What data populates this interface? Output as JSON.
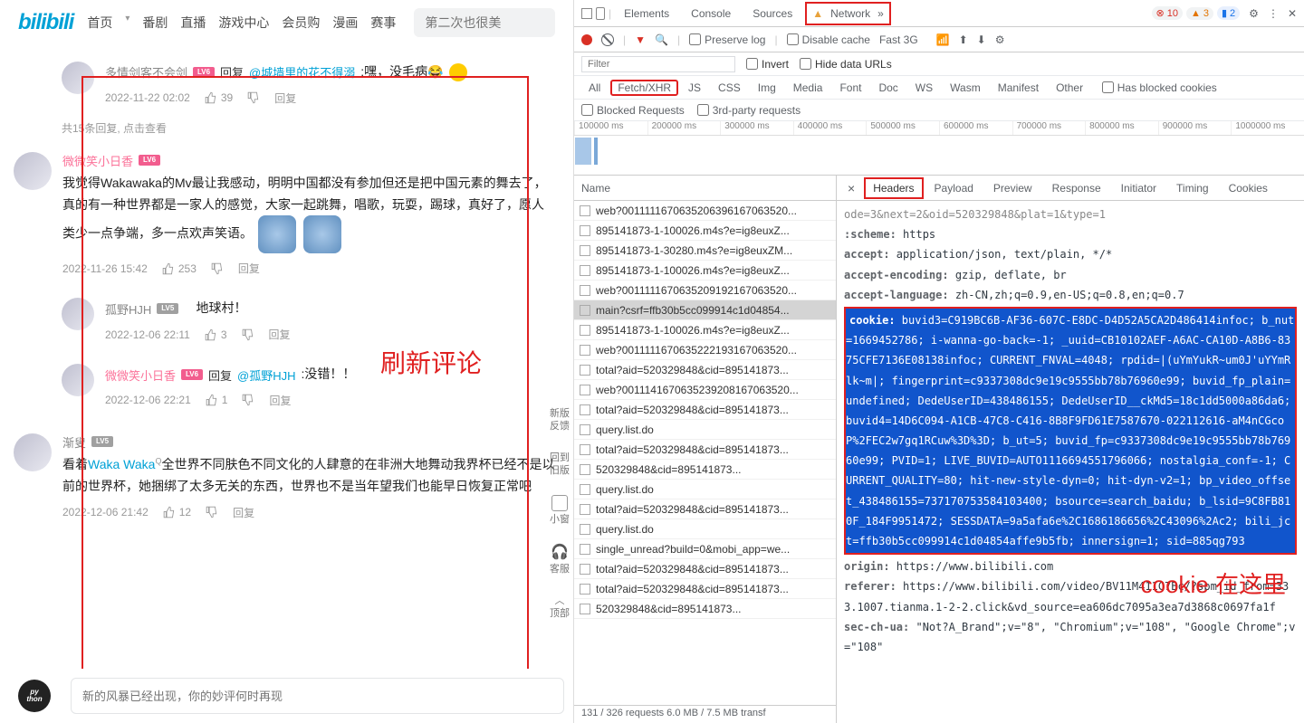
{
  "bili": {
    "logo": "bilibili",
    "nav": [
      "首页",
      "番剧",
      "直播",
      "游戏中心",
      "会员购",
      "漫画",
      "赛事"
    ],
    "search_placeholder": "第二次也很美",
    "reply_label": "回复",
    "reply_count_text": "共15条回复, 点击查看",
    "sidebar": [
      {
        "label": "新版\n反馈"
      },
      {
        "label": "回到\n旧版"
      },
      {
        "label": "小窗"
      },
      {
        "label": "客服"
      },
      {
        "label": "顶部"
      }
    ],
    "comments": [
      {
        "user": "多情剑客不会剑",
        "lv": "LV6",
        "reply_prefix": "回复 ",
        "reply_to": "@城墙里的花不得溺",
        "text": " :嘿，没毛病😂",
        "time": "2022-11-22 02:02",
        "likes": "39",
        "sub": true
      },
      {
        "user": "微微笑小日香",
        "lv": "LV6",
        "pink": true,
        "text": "我觉得Wakawaka的Mv最让我感动，明明中国都没有参加但还是把中国元素的舞去了，真的有一种世界都是一家人的感觉，大家一起跳舞，唱歌，玩耍，踢球，真好了，愿人类少一点争端，多一点欢声笑语。",
        "time": "2022-11-26 15:42",
        "likes": "253",
        "big": true,
        "stickers": 2
      },
      {
        "user": "孤野HJH",
        "lv": "LV5",
        "text": "地球村！",
        "time": "2022-12-06 22:11",
        "likes": "3",
        "sub": true
      },
      {
        "user": "微微笑小日香",
        "lv": "LV6",
        "pink": true,
        "reply_prefix": "回复 ",
        "reply_to": "@孤野HJH",
        "text": " :没错！！",
        "time": "2022-12-06 22:21",
        "likes": "1",
        "sub": true
      },
      {
        "user": "渐叟",
        "lv": "LV5",
        "text_pre": "看着",
        "text_link": "Waka Waka",
        "text_post": "全世界不同肤色不同文化的人肆意的在非洲大地舞动我界杯已经不是以前的世界杯，她捆绑了太多无关的东西，世界也不是当年望我们也能早日恢复正常吧",
        "time": "2022-12-06 21:42",
        "likes": "12",
        "big": true
      }
    ],
    "input_placeholder": "新的风暴已经出现，你的妙评何时再现",
    "overlay_text": "刷新评论"
  },
  "dt": {
    "tabs": [
      "Elements",
      "Console",
      "Sources",
      "Network"
    ],
    "more": "»",
    "err_count": "10",
    "warn_count": "3",
    "info_count": "2",
    "toolbar": {
      "preserve": "Preserve log",
      "disable": "Disable cache",
      "throttle": "Fast 3G"
    },
    "filter_placeholder": "Filter",
    "invert": "Invert",
    "hide_urls": "Hide data URLs",
    "types": [
      "All",
      "Fetch/XHR",
      "JS",
      "CSS",
      "Img",
      "Media",
      "Font",
      "Doc",
      "WS",
      "Wasm",
      "Manifest",
      "Other"
    ],
    "blocked_cookies": "Has blocked cookies",
    "blocked_req": "Blocked Requests",
    "third_party": "3rd-party requests",
    "ruler": [
      "100000 ms",
      "200000 ms",
      "300000 ms",
      "400000 ms",
      "500000 ms",
      "600000 ms",
      "700000 ms",
      "800000 ms",
      "900000 ms",
      "1000000 ms"
    ],
    "name_header": "Name",
    "requests": [
      "web?0011111670635206396167063520...",
      "895141873-1-100026.m4s?e=ig8euxZ...",
      "895141873-1-30280.m4s?e=ig8euxZM...",
      "895141873-1-100026.m4s?e=ig8euxZ...",
      "web?0011111670635209192167063520...",
      "main?csrf=ffb30b5cc099914c1d04854...",
      "895141873-1-100026.m4s?e=ig8euxZ...",
      "web?0011111670635222193167063520...",
      "total?aid=520329848&cid=895141873...",
      "web?0011141670635239208167063520...",
      "total?aid=520329848&cid=895141873...",
      "query.list.do",
      "total?aid=520329848&cid=895141873...",
      "520329848&cid=895141873...",
      "query.list.do",
      "total?aid=520329848&cid=895141873...",
      "query.list.do",
      "single_unread?build=0&mobi_app=we...",
      "total?aid=520329848&cid=895141873...",
      "total?aid=520329848&cid=895141873...",
      "520329848&cid=895141873..."
    ],
    "selected_index": 5,
    "footer": "131 / 326 requests   6.0 MB / 7.5 MB transf",
    "detail_tabs": [
      "Headers",
      "Payload",
      "Preview",
      "Response",
      "Initiator",
      "Timing",
      "Cookies"
    ],
    "headers_top": "ode=3&next=2&oid=520329848&plat=1&type=1",
    "hdr_lines": [
      {
        "n": ":scheme:",
        "v": " https"
      },
      {
        "n": "accept:",
        "v": " application/json, text/plain, */*"
      },
      {
        "n": "accept-encoding:",
        "v": " gzip, deflate, br"
      },
      {
        "n": "accept-language:",
        "v": " zh-CN,zh;q=0.9,en-US;q=0.8,en;q=0.7"
      }
    ],
    "cookie_name": "cookie:",
    "cookie_val": " buvid3=C919BC6B-AF36-607C-E8DC-D4D52A5CA2D486414infoc; b_nut=1669452786; i-wanna-go-back=-1; _uuid=CB10102AEF-A6AC-CA10D-A8B6-8375CFE7136E08138infoc; CURRENT_FNVAL=4048; rpdid=|(uYmYukR~um0J'uYYmRlk~m|; fingerprint=c9337308dc9e19c9555bb78b76960e99; buvid_fp_plain=undefined; DedeUserID=438486155; DedeUserID__ckMd5=18c1dd5000a86da6; buvid4=14D6C094-A1CB-47C8-C416-8B8F9FD61E7587670-022112616-aM4nCGcoP%2FEC2w7gq1RCuw%3D%3D; b_ut=5; buvid_fp=c9337308dc9e19c9555bb78b76960e99; PVID=1; LIVE_BUVID=AUTO1116694551796066; nostalgia_conf=-1; CURRENT_QUALITY=80; hit-new-style-dyn=0; hit-dyn-v2=1; bp_video_offset_438486155=737170753584103400; bsource=search_baidu; b_lsid=9C8FB810F_184F9951472; SESSDATA=9a5afa6e%2C1686186656%2C43096%2Ac2; bili_jct=ffb30b5cc099914c1d04854affe9b5fb; innersign=1; sid=885qg793",
    "hdr_lines2": [
      {
        "n": "origin:",
        "v": " https://www.bilibili.com"
      },
      {
        "n": "referer:",
        "v": " https://www.bilibili.com/video/BV11M411C7Bc/?spm_id_from=333.1007.tianma.1-2-2.click&vd_source=ea606dc7095a3ea7d3868c0697fa1f"
      },
      {
        "n": "sec-ch-ua:",
        "v": " \"Not?A_Brand\";v=\"8\", \"Chromium\";v=\"108\", \"Google Chrome\";v=\"108\""
      }
    ],
    "cookie_overlay": "cookie 在这里"
  }
}
